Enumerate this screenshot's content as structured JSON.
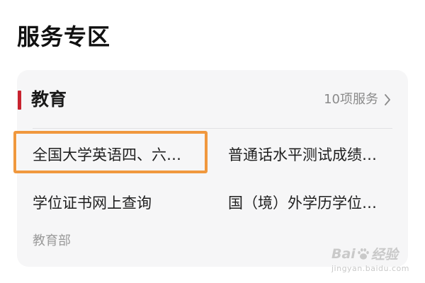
{
  "page": {
    "title": "服务专区"
  },
  "section": {
    "title": "教育",
    "service_count": "10项服务",
    "accent_color": "#c8232f",
    "chevron_icon": "chevron-right-icon",
    "items": [
      {
        "label": "全国大学英语四、六…",
        "highlighted": true
      },
      {
        "label": "普通话水平测试成绩…",
        "highlighted": false
      },
      {
        "label": "学位证书网上查询",
        "highlighted": false
      },
      {
        "label": "国（境）外学历学位…",
        "highlighted": false
      }
    ],
    "provider": "教育部",
    "highlight_color": "#f0983e"
  },
  "watermark": {
    "brand_left": "Bai",
    "brand_right": "经验",
    "url": "jingyan.baidu.com",
    "icon": "paw-icon"
  }
}
